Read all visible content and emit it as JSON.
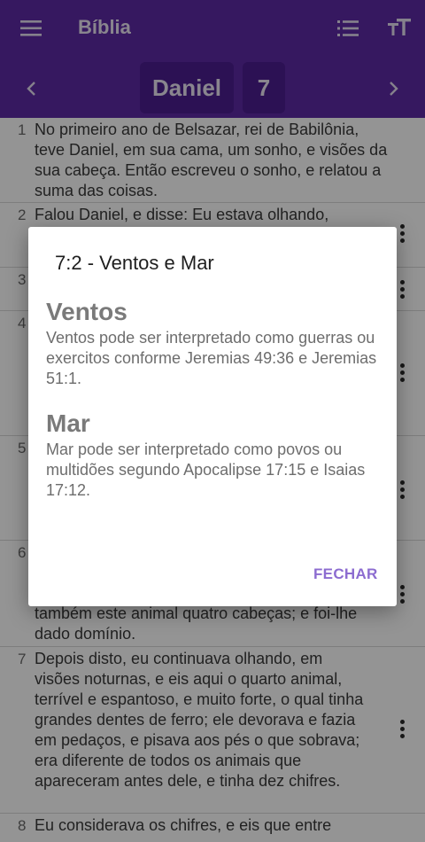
{
  "appbar": {
    "title": "Bíblia",
    "menu_icon": "hamburger-menu-icon",
    "list_icon": "list-icon",
    "text_size_icon": "text-size-icon",
    "book": "Daniel",
    "chapter": "7",
    "prev_icon": "chevron-left-icon",
    "next_icon": "chevron-right-icon"
  },
  "verses": [
    {
      "num": "1",
      "text": "No primeiro ano de Belsazar, rei de Babilônia, teve Daniel, em sua cama, um sonho, e visões da sua cabeça. Então escreveu o sonho, e relatou a suma das coisas."
    },
    {
      "num": "2",
      "text": "Falou Daniel, e disse: Eu estava olhando,"
    },
    {
      "num": "3",
      "text": ""
    },
    {
      "num": "4",
      "text": ""
    },
    {
      "num": "5",
      "text": ""
    },
    {
      "num": "6",
      "text": "também este animal quatro cabeças; e foi-lhe dado domínio."
    },
    {
      "num": "7",
      "text": "Depois disto, eu continuava olhando, em visões noturnas, e eis aqui o quarto animal, terrível e espantoso, e muito forte, o qual tinha grandes dentes de ferro; ele devorava e fazia em pedaços, e pisava aos pés o que sobrava; era diferente de todos os animais que apareceram antes dele, e tinha dez chifres."
    },
    {
      "num": "8",
      "text": "Eu considerava os chifres, e eis que entre"
    }
  ],
  "dialog": {
    "title": "7:2 - Ventos e Mar",
    "section1_heading": "Ventos",
    "section1_text": "Ventos pode ser interpretado como guerras ou exercitos conforme Jeremias 49:36 e Jeremias 51:1.",
    "section2_heading": "Mar",
    "section2_text": "Mar pode ser interpretado como povos ou multidões segundo Apocalipse 17:15 e Isaias 17:12.",
    "close_label": "FECHAR"
  },
  "colors": {
    "appbar": "#5d2aa6",
    "chip": "#4d1e92",
    "accent": "#8c6cd0"
  }
}
